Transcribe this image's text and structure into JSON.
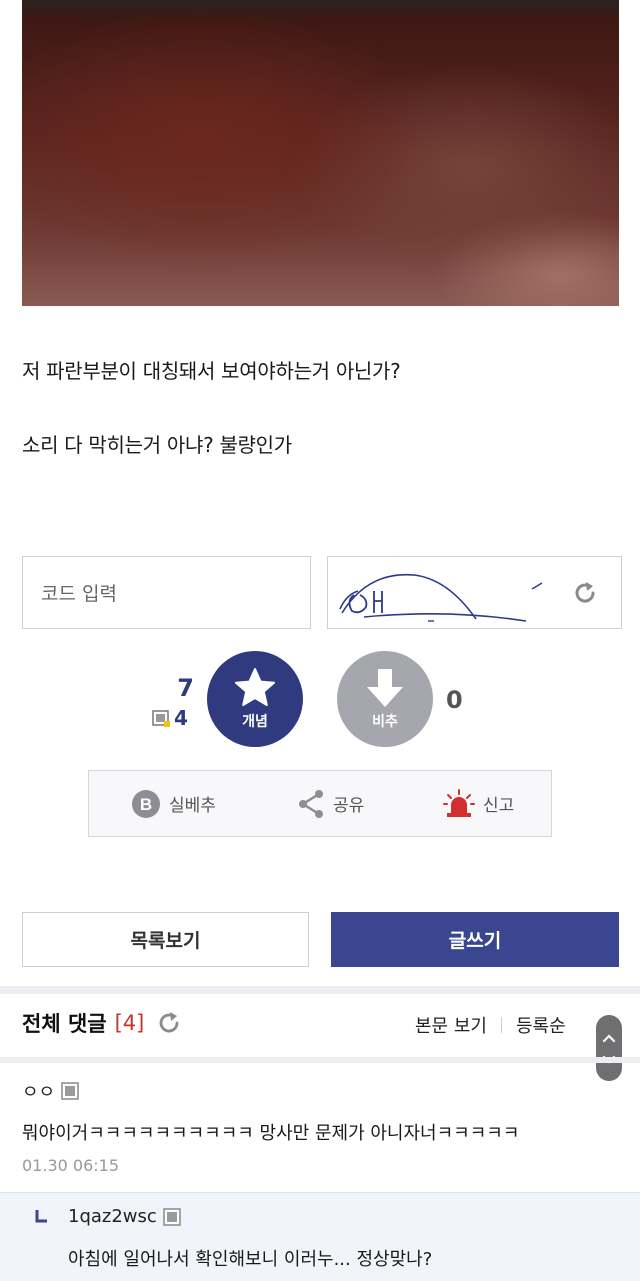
{
  "post": {
    "lines": [
      "저 파란부분이 대칭돼서 보여야하는거 아닌가?",
      "소리 다 막히는거 아냐? 불량인가"
    ]
  },
  "captcha": {
    "placeholder": "코드 입력"
  },
  "vote": {
    "up_count": "7",
    "fix_count": "4",
    "up_label": "개념",
    "down_label": "비추",
    "down_count": "0"
  },
  "actions": {
    "items": [
      {
        "label": "실베추",
        "icon": "b-badge-icon"
      },
      {
        "label": "공유",
        "icon": "share-icon"
      },
      {
        "label": "신고",
        "icon": "siren-icon"
      }
    ]
  },
  "buttons": {
    "list_label": "목록보기",
    "write_label": "글쓰기"
  },
  "comments_header": {
    "title": "전체 댓글",
    "count": "[4]",
    "view_body": "본문 보기",
    "sort_label": "등록순"
  },
  "comments": [
    {
      "author": "ㅇㅇ",
      "body": "뭐야이거ㅋㅋㅋㅋㅋㅋㅋㅋㅋㅋ 망사만 문제가 아니자너ㅋㅋㅋㅋㅋ",
      "date": "01.30 06:15"
    },
    {
      "author": "1qaz2wsc",
      "body": "아침에 일어나서 확인해보니 이러누... 정상맞나?"
    }
  ],
  "colors": {
    "accent": "#3b4690",
    "upvote": "#2f3b7e",
    "downvote": "#a6a6ae",
    "comment_count": "#c0392b",
    "report": "#d32f2f"
  }
}
